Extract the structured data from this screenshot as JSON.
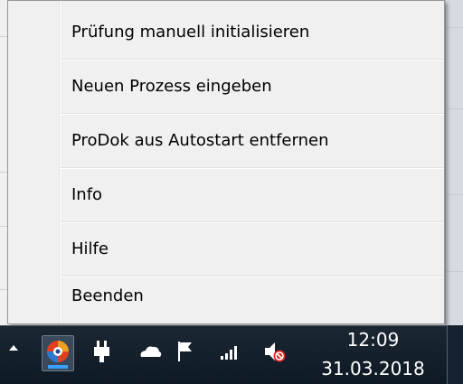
{
  "context_menu": {
    "items": [
      {
        "label": "Prüfung manuell initialisieren"
      },
      {
        "label": "Neuen Prozess eingeben"
      },
      {
        "label": "ProDok aus Autostart entfernen"
      },
      {
        "label": "Info"
      },
      {
        "label": "Hilfe"
      },
      {
        "label": "Beenden"
      }
    ]
  },
  "taskbar": {
    "tray_icons": [
      "show-hidden-icons-arrow",
      "prodok-app-icon",
      "power-plug-icon",
      "onedrive-cloud-icon",
      "action-center-flag-icon",
      "network-signal-icon",
      "volume-muted-icon"
    ],
    "clock": {
      "time": "12:09",
      "date": "31.03.2018"
    }
  },
  "colors": {
    "menu_background": "#f0f0f0",
    "taskbar_background": "#1b2733",
    "app_icon_accent": "#e04020",
    "mute_icon_red": "#e02020"
  }
}
